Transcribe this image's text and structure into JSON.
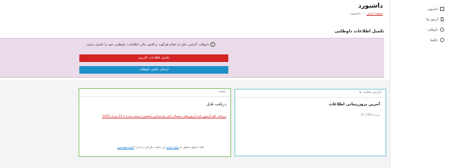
{
  "header": {
    "title": "داشبورد",
    "breadcrumb": {
      "home": "صفحه اصلی",
      "separator": "/",
      "current": "داشبورد"
    }
  },
  "profile_card": {
    "title": "تکمیل اطلاعات داوطلبی",
    "alert_text": "داوطلب گرامی، قبل از انجام هرگونه تراکنش مالی اطلاعات داوطلبی خود را تکمیل نمایید.",
    "complete_button": "تکمیل اطلاعات کاربری",
    "photo_button": "ارسال عکس داوطلب"
  },
  "guide_card": {
    "header": "راهنما",
    "title": "دریافت فایل",
    "link": "دریافت کلیه آزمون نامه آزمون‌های دیجیتال دکتر نیک‌شناس (مختص) منتشر شده تا 21 مرداد 1403"
  },
  "report_card": {
    "header": "گزارش فعالیت ها",
    "title": "آخرین بروزرسانی اطلاعات",
    "date": "21 مرداد 1403"
  },
  "footer": {
    "prefix": "کلیه حقوق متعلق به",
    "link1": "برای ایران",
    "middle": "می باشد. طراحی و اجرا:",
    "link2": "گروه مهندسی"
  },
  "sidebar": {
    "items": [
      {
        "label": "داشبورد",
        "icon": "dashboard-icon"
      },
      {
        "label": "آزمون ها",
        "icon": "test-icon"
      },
      {
        "label": "داوطلب",
        "icon": "volunteer-icon"
      },
      {
        "label": "راهنما",
        "icon": "help-icon"
      }
    ]
  },
  "colors": {
    "accent_red": "#d32424",
    "accent_blue": "#1e90c8",
    "alert_bg": "#eadbe8",
    "guide_border": "#86c36a",
    "report_border": "#7cc5cf"
  }
}
